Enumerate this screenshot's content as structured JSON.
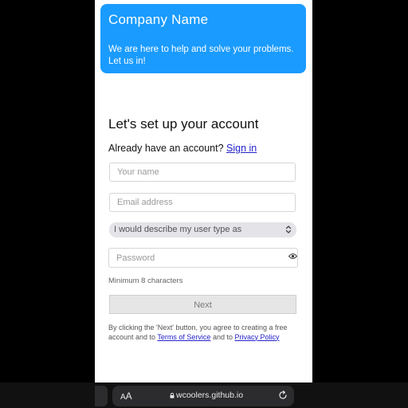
{
  "header": {
    "company_name": "Company Name",
    "tagline": "We are here to help and solve your problems. Let us in!"
  },
  "form": {
    "title": "Let's set up your account",
    "have_account_text": "Already have an account?",
    "sign_in_label": "Sign in",
    "name_placeholder": "Your name",
    "email_placeholder": "Email address",
    "user_type_selected": "I would describe my user type as",
    "password_placeholder": "Password",
    "password_hint": "Minimum 8 characters",
    "next_label": "Next",
    "legal_prefix": "By clicking the 'Next' button, you agree to creating a free account and to",
    "terms_label": "Terms of Service",
    "legal_and": "and to",
    "privacy_label": "Privacy Policy"
  },
  "browser": {
    "text_size_small": "A",
    "text_size_large": "A",
    "url": "wcoolers.github.io",
    "lock_icon": "lock-icon",
    "reload_icon": "reload-icon"
  },
  "colors": {
    "accent": "#1a9bff",
    "link": "#2222cc"
  }
}
